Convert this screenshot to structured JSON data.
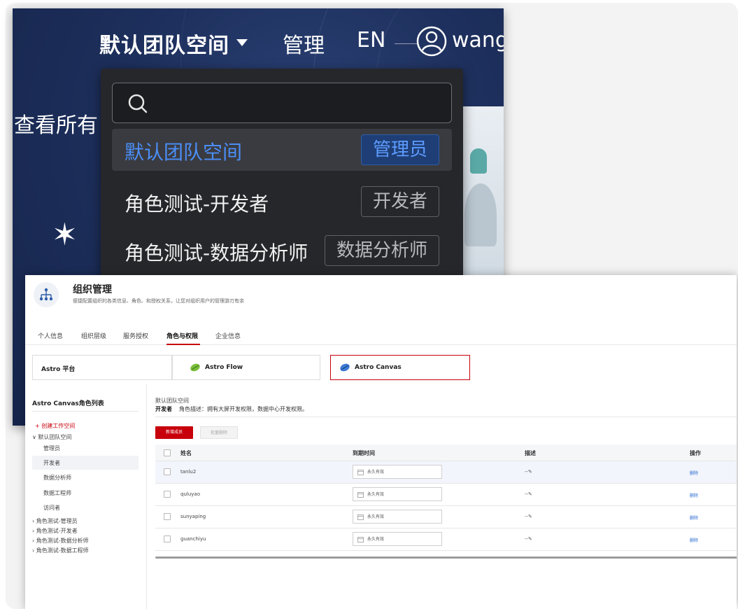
{
  "nav": {
    "workspace": "默认团队空间",
    "manage": "管理",
    "lang": "EN",
    "user": "wang"
  },
  "left_text": "查看所有",
  "dropdown": {
    "search_placeholder": "",
    "items": [
      {
        "label": "默认团队空间",
        "tag": "管理员"
      },
      {
        "label": "角色测试-开发者",
        "tag": "开发者"
      },
      {
        "label": "角色测试-数据分析师",
        "tag": "数据分析师"
      }
    ]
  },
  "org": {
    "title": "组织管理",
    "subtitle": "便捷配置组织的各类信息、角色、和授权关系，让您对组织用户的管理游刃有余",
    "tabs": [
      "个人信息",
      "组织层级",
      "服务授权",
      "角色与权限",
      "企业信息"
    ],
    "platforms": [
      "Astro 平台",
      "Astro Flow",
      "Astro Canvas"
    ]
  },
  "sidebar": {
    "title": "Astro Canvas角色列表",
    "create": "+ 创建工作空间",
    "group_open": "默认团队空间",
    "roles": [
      "管理员",
      "开发者",
      "数据分析师",
      "数据工程师",
      "访问者"
    ],
    "groups": [
      "角色测试-管理员",
      "角色测试-开发者",
      "角色测试-数据分析师",
      "角色测试-数据工程师"
    ]
  },
  "main": {
    "workspace": "默认团队空间",
    "role": "开发者",
    "role_desc": "角色描述：拥有大屏开发权限，数据中心开发权限。",
    "add_btn": "新增成员",
    "batch_del_btn": "批量删除",
    "columns": [
      "姓名",
      "到期时间",
      "描述",
      "操作"
    ],
    "rows": [
      {
        "name": "tanlu2",
        "expire": "永久有效",
        "desc": "--✎",
        "op": "删除"
      },
      {
        "name": "quluyao",
        "expire": "永久有效",
        "desc": "--✎",
        "op": "删除"
      },
      {
        "name": "sunyaping",
        "expire": "永久有效",
        "desc": "--✎",
        "op": "删除"
      },
      {
        "name": "guanchiyu",
        "expire": "永久有效",
        "desc": "--✎",
        "op": "删除"
      }
    ]
  },
  "colors": {
    "accent_red": "#c7000b",
    "dropdown_active_text": "#4b8ef7",
    "link_blue": "#2a6ad1"
  },
  "icons": [
    "search-icon",
    "user-avatar-icon",
    "org-tree-icon",
    "astro-flow-icon",
    "astro-canvas-icon",
    "calendar-icon",
    "chevron-down-icon",
    "chevron-right-icon",
    "sparkle-icon"
  ]
}
